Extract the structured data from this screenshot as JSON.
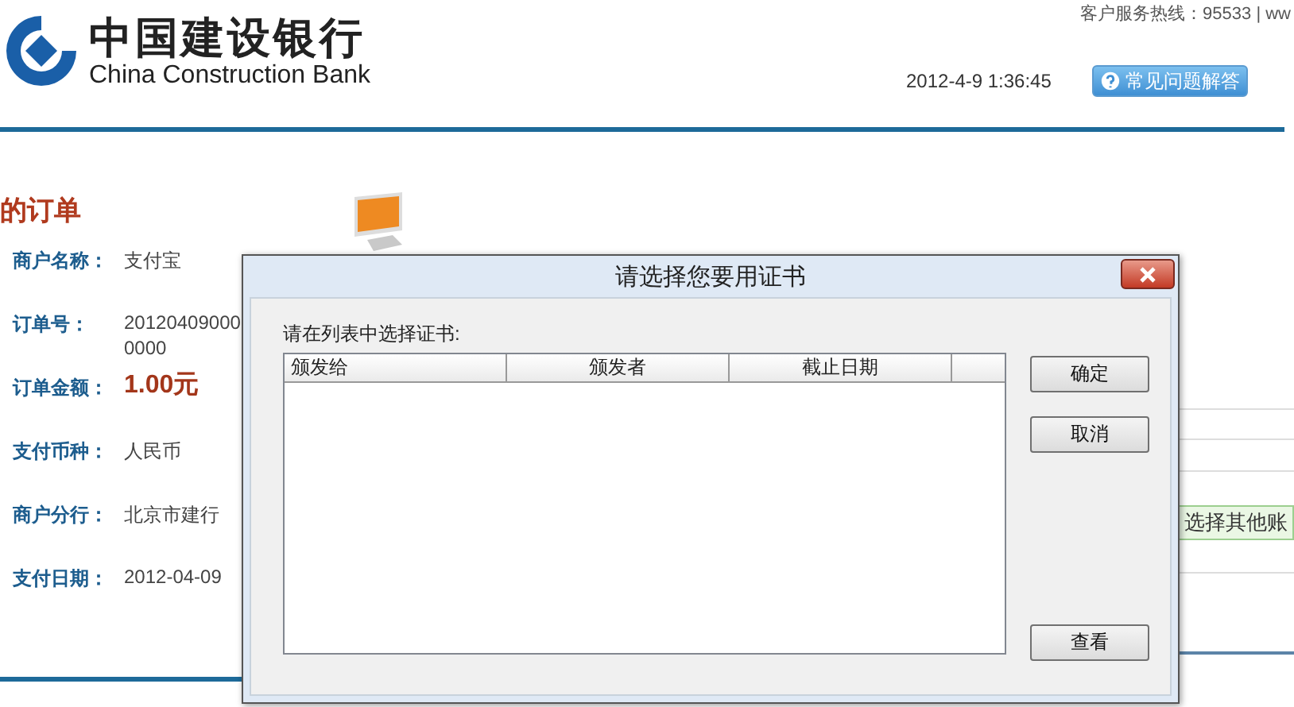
{
  "header": {
    "logo_cn": "中国建设银行",
    "logo_en": "China Construction Bank",
    "hotline": "客户服务热线：95533 | ww",
    "datetime": "2012-4-9 1:36:45",
    "help_button": "常见问题解答"
  },
  "order": {
    "title": "的订单",
    "fields": [
      {
        "label": "商户名称：",
        "value": "支付宝",
        "kind": "plain"
      },
      {
        "label": "订单号：",
        "value": "20120409000",
        "continuation": "0000",
        "kind": "plain"
      },
      {
        "label": "订单金额：",
        "value": "1.00元",
        "kind": "amount"
      },
      {
        "label": "支付币种：",
        "value": "人民币",
        "kind": "plain"
      },
      {
        "label": "商户分行：",
        "value": "北京市建行",
        "kind": "plain"
      },
      {
        "label": "支付日期：",
        "value": "2012-04-09",
        "kind": "plain"
      }
    ]
  },
  "other_account_button": "选择其他账",
  "dialog": {
    "title": "请选择您要用证书",
    "prompt": "请在列表中选择证书:",
    "columns": [
      "颁发给",
      "颁发者",
      "截止日期"
    ],
    "buttons": [
      "确定",
      "取消",
      "查看"
    ]
  }
}
